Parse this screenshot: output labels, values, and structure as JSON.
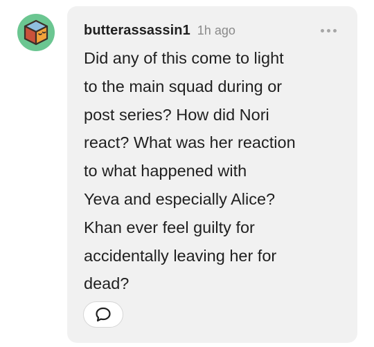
{
  "comment": {
    "username": "butterassassin1",
    "timestamp": "1h ago",
    "body_lines": [
      "Did any of this come to light",
      "to the main squad during or",
      "post series? How did Nori",
      "react? What was her reaction",
      "to what happened with",
      "Yeva and especially Alice?",
      "Khan ever feel guilty for",
      "accidentally leaving her for",
      "dead?"
    ],
    "avatar_icon": "cube-face-icon",
    "more_icon": "more-dots-icon",
    "reply_icon": "speech-bubble-icon"
  },
  "colors": {
    "avatar_bg": "#6bc691",
    "bubble_bg": "#f1f1f1",
    "text": "#1f1f1f",
    "muted": "#8a8a8a"
  }
}
